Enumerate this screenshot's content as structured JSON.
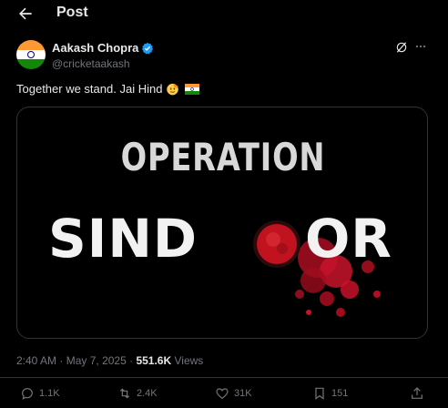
{
  "header": {
    "title": "Post",
    "back_icon": "arrow-left-icon"
  },
  "author": {
    "name": "Aakash Chopra",
    "handle": "@cricketaakash",
    "verified": true,
    "avatar": "india-flag-avatar"
  },
  "tweet": {
    "text": "Together we stand. Jai Hind",
    "emojis": [
      "saluting-face-emoji",
      "india-flag-emoji"
    ]
  },
  "media": {
    "line1": "OPERATION",
    "line2_left": "SIND",
    "line2_right": "OR"
  },
  "meta": {
    "time": "2:40 AM",
    "sep1": "·",
    "date": "May 7, 2025",
    "sep2": "·",
    "views_count": "551.6K",
    "views_label": "Views"
  },
  "actions": {
    "replies": "1.1K",
    "reposts": "2.4K",
    "likes": "31K",
    "bookmarks": "151"
  },
  "colors": {
    "background": "#000000",
    "text": "#e7e9ea",
    "muted": "#71767b",
    "verified": "#1d9bf0",
    "sindoor_red": "#d3122a"
  }
}
